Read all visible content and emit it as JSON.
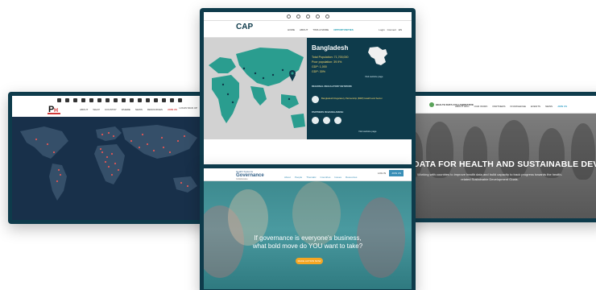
{
  "cap": {
    "logo_text": "CAP",
    "nav": [
      "HOME",
      "ABOUT",
      "TIMS & MORE",
      "OPPORTUNITIES"
    ],
    "utils": [
      "Login",
      "Connect",
      "EN"
    ],
    "country": "Bangladesh",
    "stats": [
      "Total Population: 71,700,000",
      "Poor population: 39.9%",
      "GDP: 1,000",
      "GDP: 30%"
    ],
    "regional_label": "REGIONAL REGULATORY NETWORK",
    "regulator_name": "Bangladesh Regulatory Partnership (BRP) Health and Sector",
    "visit_link": "Visit website page",
    "partners_label": "PARTNERS IN BANGLADESH",
    "visit_link_2": "Visit website page",
    "colors": {
      "panel": "#0e3b4b",
      "accent": "#1a9bb0",
      "stat": "#f5d76e",
      "map": "#2a9d8f"
    }
  },
  "map_site": {
    "logo_text": "P4H",
    "nav": [
      "ABOUT",
      "WHAT",
      "COUNTRY",
      "WHERE",
      "NEWS",
      "RESOURCES",
      "JOIN US"
    ],
    "utils": "LOGIN  SIGN UP",
    "colors": {
      "bg": "#18304a",
      "dot": "#e05656",
      "land": "#3b556f"
    }
  },
  "health": {
    "logo_text": "HEALTH DATA COLLABORATIVE",
    "nav": [
      "ABOUT HDC",
      "OUR WORK",
      "PARTNERS",
      "KNOWLEDGE",
      "EVENTS",
      "NEWS",
      "JOIN US"
    ],
    "hero_title": "DATA FOR HEALTH AND SUSTAINABLE DEVELOPMENT",
    "hero_subtitle": "Working with countries to improve health data and build capacity to track progress towards the health-related Sustainable Development Goals."
  },
  "governance": {
    "logo_line1": "Health Systems",
    "logo_line2": "Governance",
    "logo_line3": "Collaborative",
    "nav": [
      "About",
      "People",
      "Thematic",
      "Countries",
      "Issues",
      "Resources"
    ],
    "utils_text": "LOG IN",
    "join_label": "JOIN US",
    "headline": "If governance is everyone's business, what bold move do YOU want to take?",
    "cta_label": "MAKE ACTION NOW"
  }
}
